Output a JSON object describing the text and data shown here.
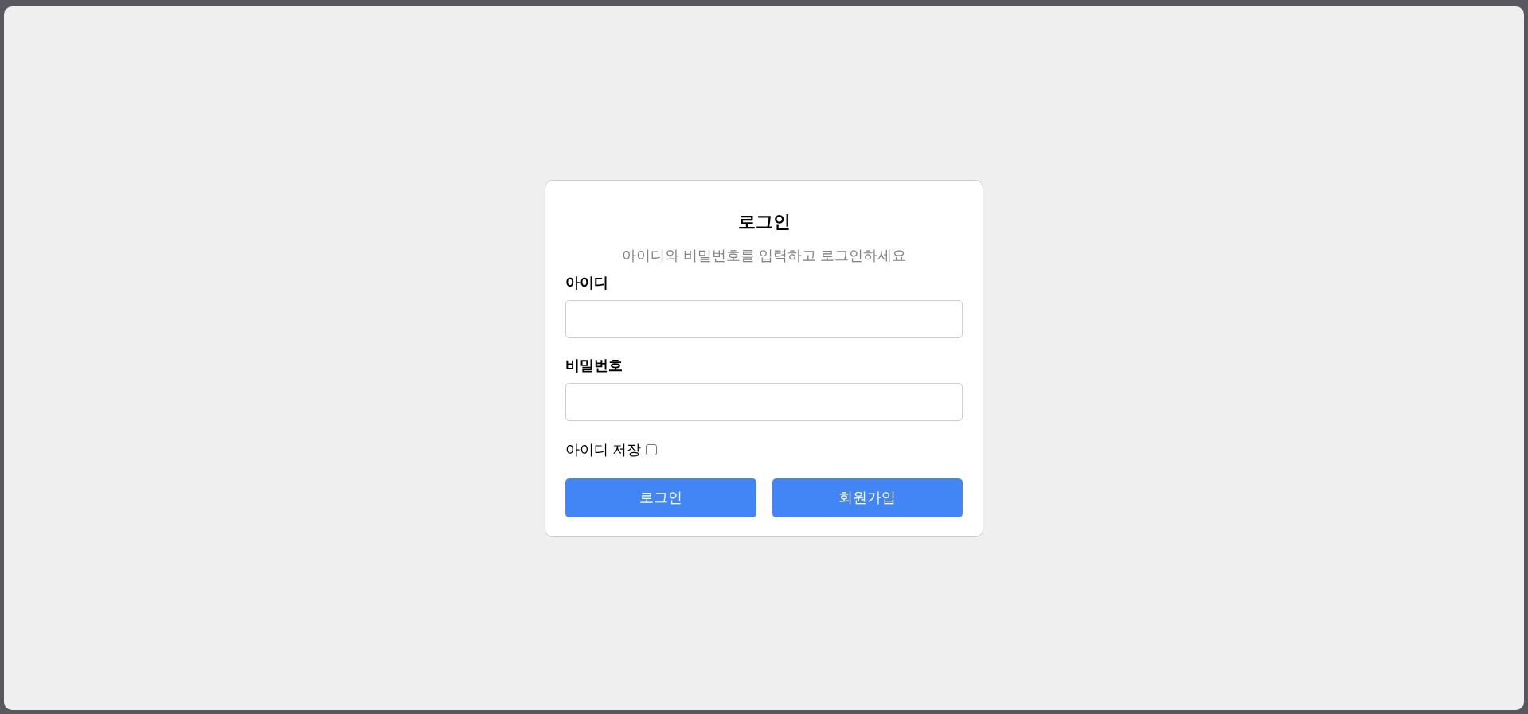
{
  "login_card": {
    "title": "로그인",
    "subtitle": "아이디와 비밀번호를 입력하고 로그인하세요",
    "fields": [
      {
        "label": "아이디"
      },
      {
        "label": "비밀번호"
      }
    ],
    "remember": {
      "label": "아이디 저장",
      "checked": false
    },
    "buttons": [
      {
        "label": "로그인"
      },
      {
        "label": "회원가입"
      }
    ]
  }
}
